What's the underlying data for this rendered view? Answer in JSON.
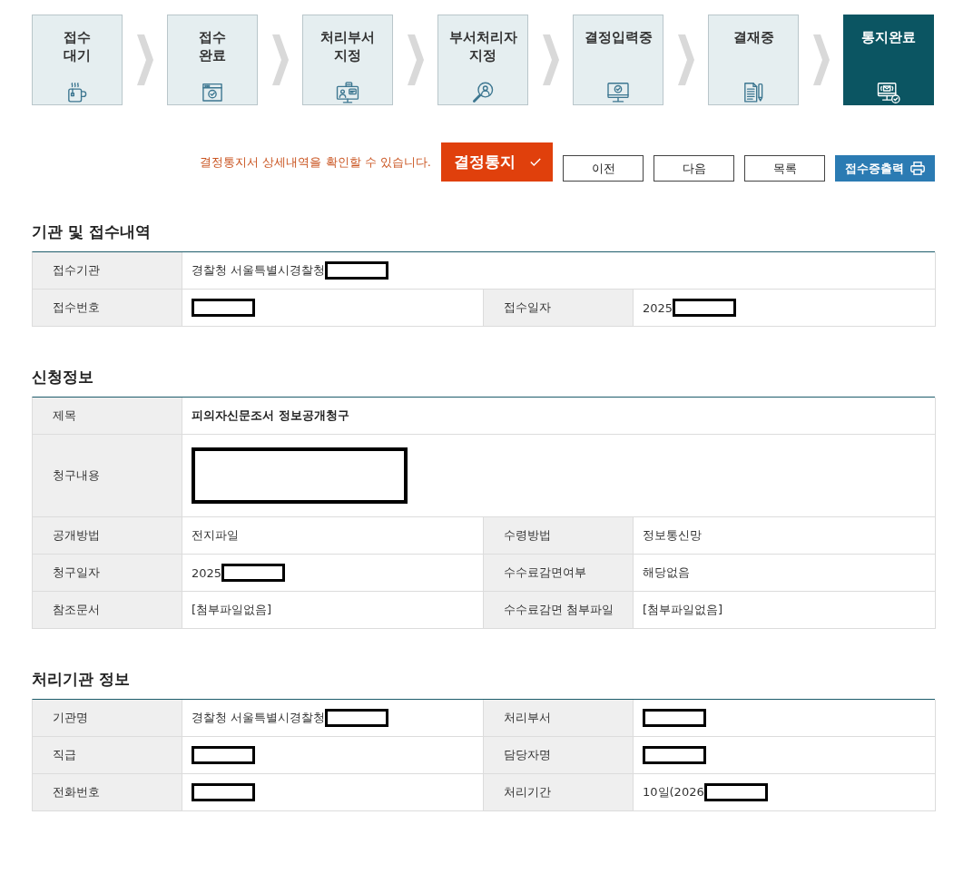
{
  "steps": [
    {
      "label": "접수\n대기",
      "current": false
    },
    {
      "label": "접수\n완료",
      "current": false
    },
    {
      "label": "처리부서\n지정",
      "current": false
    },
    {
      "label": "부서처리자\n지정",
      "current": false
    },
    {
      "label": "결정입력중",
      "current": false
    },
    {
      "label": "결재중",
      "current": false
    },
    {
      "label": "통지완료",
      "current": true
    }
  ],
  "notice": {
    "message": "결정통지서 상세내역을 확인할 수 있습니다."
  },
  "buttons": [
    {
      "label": "결정통지",
      "kind": "decision"
    },
    {
      "label": "이전",
      "kind": "nav"
    },
    {
      "label": "다음",
      "kind": "nav"
    },
    {
      "label": "목록",
      "kind": "nav"
    },
    {
      "label": "접수증출력",
      "kind": "print"
    }
  ],
  "sections": [
    {
      "title": "기관 및 접수내역",
      "rows": [
        {
          "fields": [
            {
              "kind": "line",
              "label": "접수기관",
              "value": "경찰청 서울특별시경찰청",
              "redacted": true
            }
          ]
        },
        {
          "fields": [
            {
              "kind": "line",
              "label": "접수번호",
              "redacted": true
            },
            {
              "kind": "line",
              "label": "접수일자",
              "value": "2025",
              "redacted": true
            }
          ]
        }
      ]
    },
    {
      "title": "신청정보",
      "rows": [
        {
          "fields": [
            {
              "kind": "title",
              "label": "제목",
              "value": "피의자신문조서 정보공개청구",
              "redacted": false
            }
          ]
        },
        {
          "fields": [
            {
              "kind": "area",
              "label": "청구내용",
              "redacted": true
            }
          ]
        },
        {
          "fields": [
            {
              "kind": "line",
              "label": "공개방법",
              "value": "전지파일",
              "redacted": false
            },
            {
              "kind": "line",
              "label": "수령방법",
              "value": "정보통신망",
              "redacted": false
            }
          ]
        },
        {
          "fields": [
            {
              "kind": "line",
              "label": "청구일자",
              "value": "2025",
              "redacted": true
            },
            {
              "kind": "line",
              "label": "수수료감면여부",
              "value": "해당없음",
              "redacted": false
            }
          ]
        },
        {
          "fields": [
            {
              "kind": "line",
              "label": "참조문서",
              "value": "[첨부파일없음]",
              "redacted": false
            },
            {
              "kind": "line",
              "label": "수수료감면 첨부파일",
              "value": "[첨부파일없음]",
              "redacted": false
            }
          ]
        }
      ]
    },
    {
      "title": "처리기관 정보",
      "rows": [
        {
          "fields": [
            {
              "kind": "line",
              "label": "기관명",
              "value": "경찰청 서울특별시경찰청",
              "redacted": true
            },
            {
              "kind": "line",
              "label": "처리부서",
              "redacted": true
            }
          ]
        },
        {
          "fields": [
            {
              "kind": "line",
              "label": "직급",
              "redacted": true
            },
            {
              "kind": "line",
              "label": "담당자명",
              "redacted": true
            }
          ]
        },
        {
          "fields": [
            {
              "kind": "line",
              "label": "전화번호",
              "redacted": true
            },
            {
              "kind": "line",
              "label": "처리기간",
              "value": "10일(2026",
              "redacted": true
            }
          ]
        }
      ]
    }
  ]
}
